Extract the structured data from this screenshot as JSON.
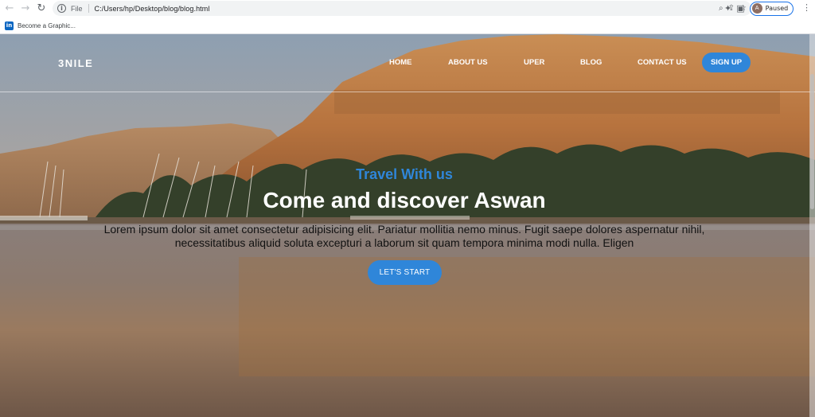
{
  "browser": {
    "scheme_label": "File",
    "url": "C:/Users/hp/Desktop/blog/blog.html",
    "profile_initial": "A",
    "profile_status": "Paused",
    "bookmark_label": "Become a Graphic...",
    "bookmark_icon": "linkedin-icon"
  },
  "site": {
    "logo": "3NILE",
    "nav": [
      "HOME",
      "ABOUT US",
      "UPER",
      "BLOG",
      "CONTACT US"
    ],
    "signup_label": "SIGN UP"
  },
  "hero": {
    "kicker": "Travel With us",
    "headline": "Come and discover Aswan",
    "body": "Lorem ipsum dolor sit amet consectetur adipisicing elit. Pariatur mollitia nemo minus. Fugit saepe dolores aspernatur nihil, necessitatibus aliquid soluta excepturi a laborum sit quam tempora minima modi nulla. Eligen",
    "cta_label": "LET'S START"
  },
  "colors": {
    "accent": "#2f86d9",
    "headline": "#ffffff",
    "body_text": "#111111"
  }
}
